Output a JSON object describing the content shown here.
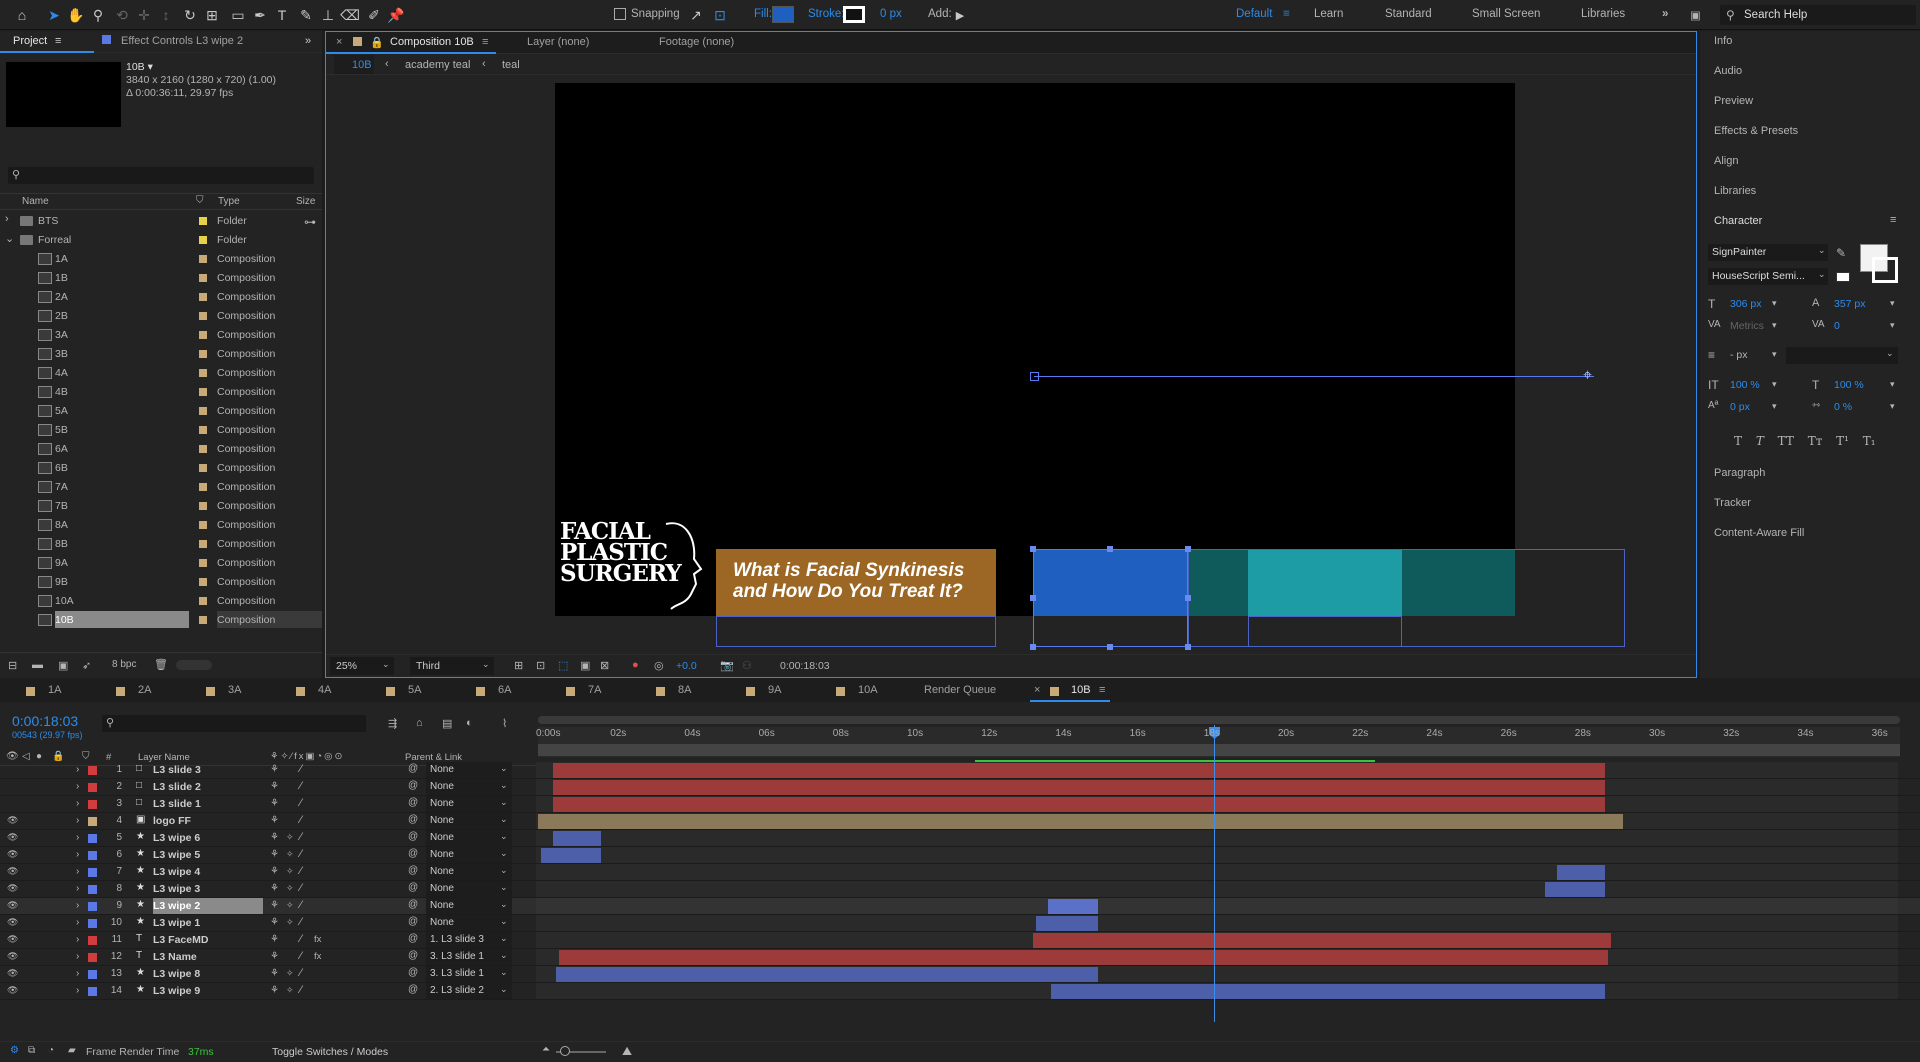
{
  "toolbar": {
    "snapping": "Snapping",
    "fill": "Fill:",
    "stroke": "Stroke:",
    "stroke_px": "0 px",
    "add": "Add:",
    "fill_color": "#1f5fbf",
    "workspaces": [
      "Default",
      "Learn",
      "Standard",
      "Small Screen",
      "Libraries"
    ],
    "search": "Search Help"
  },
  "project": {
    "tab": "Project",
    "effect_tab": "Effect Controls L3 wipe 2",
    "item_name": "10B ▾",
    "item_res": "3840 x 2160  (1280 x 720) (1.00)",
    "item_dur": "Δ 0:00:36:11, 29.97 fps",
    "cols": {
      "name": "Name",
      "type": "Type",
      "size": "Size"
    },
    "rows": [
      {
        "name": "BTS",
        "type": "Folder",
        "kind": "folder",
        "color": "#e6d24a",
        "indent": 0,
        "arrow": "›"
      },
      {
        "name": "Forreal",
        "type": "Folder",
        "kind": "folder",
        "color": "#e6d24a",
        "indent": 0,
        "arrow": "⌄"
      },
      {
        "name": "1A",
        "type": "Composition",
        "kind": "comp",
        "color": "#c8aa78"
      },
      {
        "name": "1B",
        "type": "Composition",
        "kind": "comp",
        "color": "#c8aa78"
      },
      {
        "name": "2A",
        "type": "Composition",
        "kind": "comp",
        "color": "#c8aa78"
      },
      {
        "name": "2B",
        "type": "Composition",
        "kind": "comp",
        "color": "#c8aa78"
      },
      {
        "name": "3A",
        "type": "Composition",
        "kind": "comp",
        "color": "#c8aa78"
      },
      {
        "name": "3B",
        "type": "Composition",
        "kind": "comp",
        "color": "#c8aa78"
      },
      {
        "name": "4A",
        "type": "Composition",
        "kind": "comp",
        "color": "#c8aa78"
      },
      {
        "name": "4B",
        "type": "Composition",
        "kind": "comp",
        "color": "#c8aa78"
      },
      {
        "name": "5A",
        "type": "Composition",
        "kind": "comp",
        "color": "#c8aa78"
      },
      {
        "name": "5B",
        "type": "Composition",
        "kind": "comp",
        "color": "#c8aa78"
      },
      {
        "name": "6A",
        "type": "Composition",
        "kind": "comp",
        "color": "#c8aa78"
      },
      {
        "name": "6B",
        "type": "Composition",
        "kind": "comp",
        "color": "#c8aa78"
      },
      {
        "name": "7A",
        "type": "Composition",
        "kind": "comp",
        "color": "#c8aa78"
      },
      {
        "name": "7B",
        "type": "Composition",
        "kind": "comp",
        "color": "#c8aa78"
      },
      {
        "name": "8A",
        "type": "Composition",
        "kind": "comp",
        "color": "#c8aa78"
      },
      {
        "name": "8B",
        "type": "Composition",
        "kind": "comp",
        "color": "#c8aa78"
      },
      {
        "name": "9A",
        "type": "Composition",
        "kind": "comp",
        "color": "#c8aa78"
      },
      {
        "name": "9B",
        "type": "Composition",
        "kind": "comp",
        "color": "#c8aa78"
      },
      {
        "name": "10A",
        "type": "Composition",
        "kind": "comp",
        "color": "#c8aa78"
      },
      {
        "name": "10B",
        "type": "Composition",
        "kind": "comp",
        "color": "#c8aa78",
        "selected": true
      }
    ],
    "bpc": "8 bpc"
  },
  "comp": {
    "tab": "Composition 10B",
    "layer_tab": "Layer (none)",
    "footage_tab": "Footage (none)",
    "breadcrumbs": [
      "10B",
      "academy teal",
      "teal"
    ],
    "zoom": "25%",
    "view": "Third",
    "exposure": "+0.0",
    "timecode": "0:00:18:03",
    "logo_lines": [
      "FACIAL",
      "PLASTIC",
      "SURGERY"
    ],
    "lower_third": "What is Facial Synkinesis and How Do You Treat It?"
  },
  "right": {
    "info": "Info",
    "audio": "Audio",
    "preview": "Preview",
    "effects": "Effects & Presets",
    "align": "Align",
    "libraries": "Libraries",
    "character": "Character",
    "font": "SignPainter",
    "style": "HouseScript Semi...",
    "size": "306 px",
    "leading": "357 px",
    "kerning": "Metrics",
    "tracking": "0",
    "stroke_px": "- px",
    "vscale": "100 %",
    "hscale": "100 %",
    "baseline": "0 px",
    "tsume": "0 %",
    "paragraph": "Paragraph",
    "tracker": "Tracker",
    "caf": "Content-Aware Fill"
  },
  "timeline": {
    "tabs": [
      "1A",
      "2A",
      "3A",
      "4A",
      "5A",
      "6A",
      "7A",
      "8A",
      "9A",
      "10A"
    ],
    "render_queue": "Render Queue",
    "active_tab": "10B",
    "timecode": "0:00:18:03",
    "frames": "00543 (29.97 fps)",
    "col_layer": "Layer Name",
    "col_parent": "Parent & Link",
    "col_num": "#",
    "ticks": [
      "0:00s",
      "02s",
      "04s",
      "06s",
      "08s",
      "10s",
      "12s",
      "14s",
      "16s",
      "18s",
      "20s",
      "22s",
      "24s",
      "26s",
      "28s",
      "30s",
      "32s",
      "34s",
      "36s"
    ],
    "layers": [
      {
        "num": "1",
        "name": "L3 slide 3",
        "icon": "□",
        "color": "#d23c3c",
        "parent": "None",
        "fx": false,
        "vis": false
      },
      {
        "num": "2",
        "name": "L3 slide 2",
        "icon": "□",
        "color": "#d23c3c",
        "parent": "None",
        "fx": false,
        "vis": false
      },
      {
        "num": "3",
        "name": "L3 slide 1",
        "icon": "□",
        "color": "#d23c3c",
        "parent": "None",
        "fx": false,
        "vis": false
      },
      {
        "num": "4",
        "name": "logo FF",
        "icon": "▣",
        "color": "#c8aa78",
        "parent": "None",
        "fx": false,
        "vis": true
      },
      {
        "num": "5",
        "name": "L3 wipe 6",
        "icon": "★",
        "color": "#5a78e6",
        "parent": "None",
        "fx": false,
        "vis": true
      },
      {
        "num": "6",
        "name": "L3 wipe 5",
        "icon": "★",
        "color": "#5a78e6",
        "parent": "None",
        "fx": false,
        "vis": true
      },
      {
        "num": "7",
        "name": "L3 wipe 4",
        "icon": "★",
        "color": "#5a78e6",
        "parent": "None",
        "fx": false,
        "vis": true
      },
      {
        "num": "8",
        "name": "L3 wipe 3",
        "icon": "★",
        "color": "#5a78e6",
        "parent": "None",
        "fx": false,
        "vis": true
      },
      {
        "num": "9",
        "name": "L3 wipe 2",
        "icon": "★",
        "color": "#5a78e6",
        "parent": "None",
        "fx": false,
        "vis": true,
        "selected": true
      },
      {
        "num": "10",
        "name": "L3 wipe 1",
        "icon": "★",
        "color": "#5a78e6",
        "parent": "None",
        "fx": false,
        "vis": true
      },
      {
        "num": "11",
        "name": "L3 FaceMD",
        "icon": "T",
        "color": "#d23c3c",
        "parent": "1. L3 slide 3",
        "fx": true,
        "vis": true
      },
      {
        "num": "12",
        "name": "L3 Name",
        "icon": "T",
        "color": "#d23c3c",
        "parent": "3. L3 slide 1",
        "fx": true,
        "vis": true
      },
      {
        "num": "13",
        "name": "L3 wipe 8",
        "icon": "★",
        "color": "#5a78e6",
        "parent": "3. L3 slide 1",
        "fx": false,
        "vis": true
      },
      {
        "num": "14",
        "name": "L3 wipe 9",
        "icon": "★",
        "color": "#5a78e6",
        "parent": "2. L3 slide 2",
        "fx": false,
        "vis": true
      }
    ],
    "render_time_label": "Frame Render Time",
    "render_time": "37ms",
    "toggle": "Toggle Switches / Modes"
  }
}
